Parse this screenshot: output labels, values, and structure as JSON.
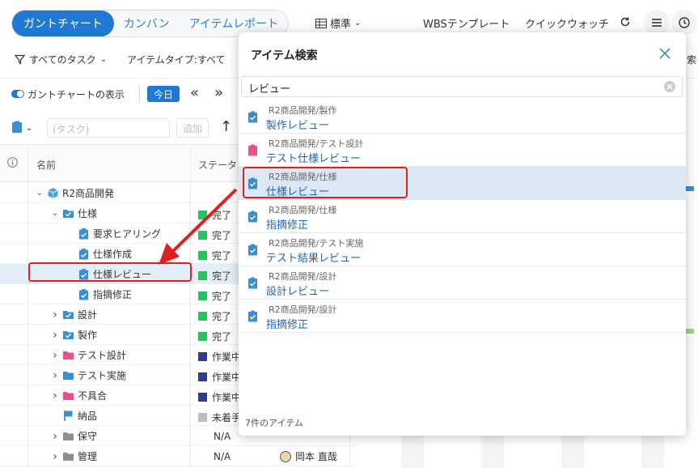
{
  "topbar": {
    "tabs": [
      {
        "label": "ガントチャート",
        "active": true
      },
      {
        "label": "カンバン",
        "active": false
      },
      {
        "label": "アイテムレポート",
        "active": false
      }
    ],
    "layout_label": "標準",
    "wbs_template": "WBSテンプレート",
    "quick_watch": "クイックウォッチ"
  },
  "filters": {
    "all_tasks": "すべてのタスク",
    "item_type": "アイテムタイプ:すべて",
    "right_truncated": "索"
  },
  "gantt_row": {
    "show_gantt": "ガントチャートの表示",
    "today": "今日"
  },
  "task_row": {
    "placeholder": "(タスク)",
    "add": "追加"
  },
  "table": {
    "headers": {
      "name": "名前",
      "status": "ステータス"
    },
    "rows": [
      {
        "name": "R2商品開発",
        "indent": 0,
        "chevron": "down",
        "icon": "cube",
        "status": "",
        "status_color": ""
      },
      {
        "name": "仕様",
        "indent": 1,
        "chevron": "down",
        "icon": "folder-check",
        "status": "完了",
        "status_color": "#22c55e"
      },
      {
        "name": "要求ヒアリング",
        "indent": 2,
        "chevron": "",
        "icon": "task-check",
        "status": "完了",
        "status_color": "#22c55e"
      },
      {
        "name": "仕様作成",
        "indent": 2,
        "chevron": "",
        "icon": "task-check",
        "status": "完了",
        "status_color": "#22c55e"
      },
      {
        "name": "仕様レビュー",
        "indent": 2,
        "chevron": "",
        "icon": "task-check",
        "status": "完了",
        "status_color": "#22c55e",
        "selected": true
      },
      {
        "name": "指摘修正",
        "indent": 2,
        "chevron": "",
        "icon": "task-check",
        "status": "完了",
        "status_color": "#22c55e"
      },
      {
        "name": "設計",
        "indent": 1,
        "chevron": "right",
        "icon": "folder-check",
        "status": "完了",
        "status_color": "#22c55e"
      },
      {
        "name": "製作",
        "indent": 1,
        "chevron": "right",
        "icon": "folder-check",
        "status": "完了",
        "status_color": "#22c55e"
      },
      {
        "name": "テスト設計",
        "indent": 1,
        "chevron": "right",
        "icon": "folder-pink",
        "status": "作業中",
        "status_color": "#2e3d8f"
      },
      {
        "name": "テスト実施",
        "indent": 1,
        "chevron": "right",
        "icon": "folder-blue",
        "status": "作業中",
        "status_color": "#2e3d8f"
      },
      {
        "name": "不具合",
        "indent": 1,
        "chevron": "right",
        "icon": "folder-pink",
        "status": "作業中",
        "status_color": "#2e3d8f"
      },
      {
        "name": "納品",
        "indent": 1,
        "chevron": "",
        "icon": "flag",
        "status": "未着手",
        "status_color": "#bdbdbd"
      },
      {
        "name": "保守",
        "indent": 1,
        "chevron": "right",
        "icon": "folder-gray",
        "status": "N/A",
        "status_color": ""
      },
      {
        "name": "管理",
        "indent": 1,
        "chevron": "right",
        "icon": "folder-gray",
        "status": "N/A",
        "status_color": "",
        "assignee": "岡本 直哉"
      }
    ]
  },
  "dialog": {
    "title": "アイテム検索",
    "search_value": "レビュー",
    "results": [
      {
        "path": "R2商品開発/製作",
        "name": "製作レビュー",
        "icon_color": "#3b8fd1"
      },
      {
        "path": "R2商品開発/テスト設計",
        "name": "テスト仕様レビュー",
        "icon_color": "#e8508a"
      },
      {
        "path": "R2商品開発/仕様",
        "name": "仕様レビュー",
        "icon_color": "#3b8fd1",
        "selected": true
      },
      {
        "path": "R2商品開発/仕様",
        "name": "指摘修正",
        "icon_color": "#3b8fd1"
      },
      {
        "path": "R2商品開発/テスト実施",
        "name": "テスト結果レビュー",
        "icon_color": "#3b8fd1"
      },
      {
        "path": "R2商品開発/設計",
        "name": "設計レビュー",
        "icon_color": "#3b8fd1"
      },
      {
        "path": "R2商品開発/設計",
        "name": "指摘修正",
        "icon_color": "#3b8fd1"
      }
    ],
    "count_label": "7件のアイテム"
  },
  "colors": {
    "accent": "#1f78d1",
    "highlight": "#e02020",
    "link": "#1f63b8"
  }
}
